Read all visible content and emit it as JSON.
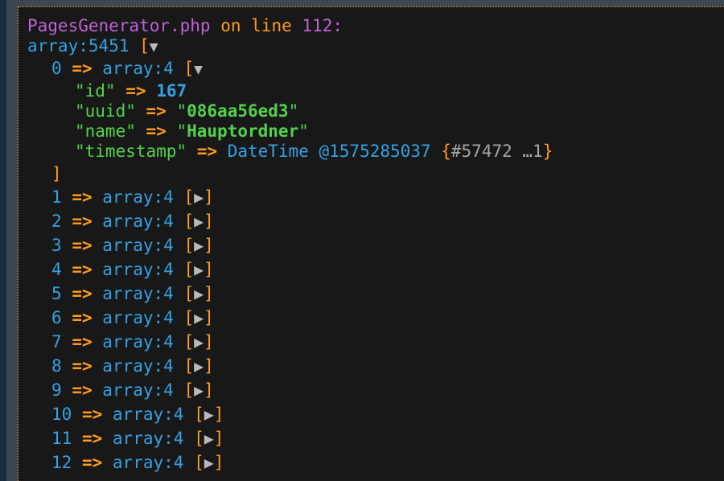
{
  "header": {
    "file": "PagesGenerator.php",
    "on_line": "on line",
    "line_number": "112:"
  },
  "root": {
    "type": "array:5451",
    "open_bracket": "[",
    "toggle_icon": "triangle-down-icon"
  },
  "expanded_item": {
    "key": "0",
    "arrow": "=>",
    "type": "array:4",
    "open_bracket": "[",
    "close_bracket": "]",
    "toggle_icon": "triangle-down-icon",
    "fields": {
      "id": {
        "key": "\"id\"",
        "arrow": "=>",
        "value": "167"
      },
      "uuid": {
        "key": "\"uuid\"",
        "arrow": "=>",
        "quote_open": "\"",
        "value": "086aa56ed3",
        "quote_close": "\""
      },
      "name": {
        "key": "\"name\"",
        "arrow": "=>",
        "quote_open": "\"",
        "value": "Hauptordner",
        "quote_close": "\""
      },
      "timestamp": {
        "key": "\"timestamp\"",
        "arrow": "=>",
        "class": "DateTime",
        "ts": "@1575285037",
        "brace_open": "{",
        "ref": "#57472 …1",
        "brace_close": "}"
      }
    }
  },
  "collapsed_items": [
    {
      "key": "1",
      "arrow": "=>",
      "type": "array:4",
      "open": "[",
      "close": "]",
      "toggle_icon": "triangle-right-icon"
    },
    {
      "key": "2",
      "arrow": "=>",
      "type": "array:4",
      "open": "[",
      "close": "]",
      "toggle_icon": "triangle-right-icon"
    },
    {
      "key": "3",
      "arrow": "=>",
      "type": "array:4",
      "open": "[",
      "close": "]",
      "toggle_icon": "triangle-right-icon"
    },
    {
      "key": "4",
      "arrow": "=>",
      "type": "array:4",
      "open": "[",
      "close": "]",
      "toggle_icon": "triangle-right-icon"
    },
    {
      "key": "5",
      "arrow": "=>",
      "type": "array:4",
      "open": "[",
      "close": "]",
      "toggle_icon": "triangle-right-icon"
    },
    {
      "key": "6",
      "arrow": "=>",
      "type": "array:4",
      "open": "[",
      "close": "]",
      "toggle_icon": "triangle-right-icon"
    },
    {
      "key": "7",
      "arrow": "=>",
      "type": "array:4",
      "open": "[",
      "close": "]",
      "toggle_icon": "triangle-right-icon"
    },
    {
      "key": "8",
      "arrow": "=>",
      "type": "array:4",
      "open": "[",
      "close": "]",
      "toggle_icon": "triangle-right-icon"
    },
    {
      "key": "9",
      "arrow": "=>",
      "type": "array:4",
      "open": "[",
      "close": "]",
      "toggle_icon": "triangle-right-icon"
    },
    {
      "key": "10",
      "arrow": "=>",
      "type": "array:4",
      "open": "[",
      "close": "]",
      "toggle_icon": "triangle-right-icon"
    },
    {
      "key": "11",
      "arrow": "=>",
      "type": "array:4",
      "open": "[",
      "close": "]",
      "toggle_icon": "triangle-right-icon"
    },
    {
      "key": "12",
      "arrow": "=>",
      "type": "array:4",
      "open": "[",
      "close": "]",
      "toggle_icon": "triangle-right-icon"
    }
  ],
  "colors": {
    "background": "#181818",
    "file": "#c062d6",
    "operator": "#ff9a1f",
    "key": "#35a1e3",
    "string": "#52d24a",
    "toggle": "#b9b9b9"
  }
}
